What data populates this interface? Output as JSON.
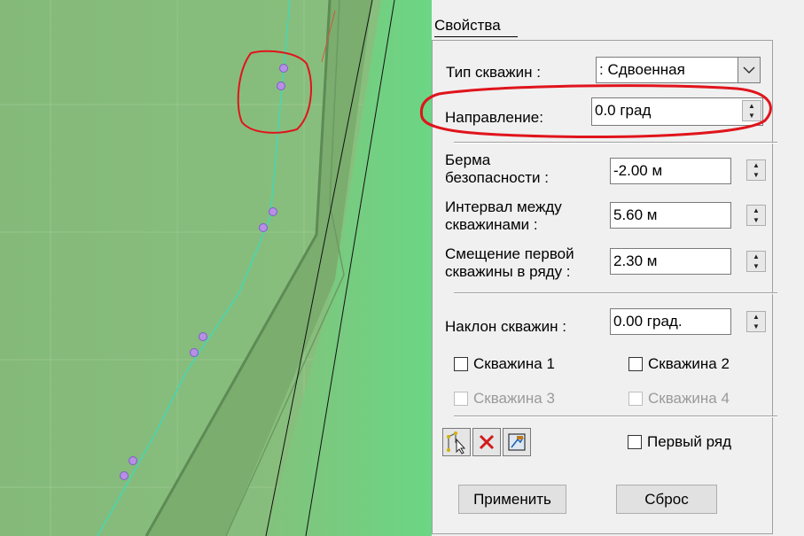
{
  "panel": {
    "title": "Свойства",
    "well_type": {
      "label": "Тип скважин :",
      "value": ": Сдвоенная"
    },
    "direction": {
      "label": "Направление:",
      "value": "0.0 град"
    },
    "safety_berm": {
      "label_line1": "Берма",
      "label_line2": "безопасности :",
      "value": "-2.00 м"
    },
    "well_interval": {
      "label_line1": "Интервал между",
      "label_line2": "скважинами :",
      "value": "5.60 м"
    },
    "first_well_offset": {
      "label_line1": "Смещение первой",
      "label_line2": "скважины в ряду :",
      "value": "2.30 м"
    },
    "well_incline": {
      "label": "Наклон скважин :",
      "value": "0.00 град."
    },
    "checkboxes": {
      "well1": {
        "label": "Скважина 1",
        "enabled": true,
        "checked": false
      },
      "well2": {
        "label": "Скважина 2",
        "enabled": true,
        "checked": false
      },
      "well3": {
        "label": "Скважина 3",
        "enabled": false,
        "checked": false
      },
      "well4": {
        "label": "Скважина 4",
        "enabled": false,
        "checked": false
      },
      "first_row": {
        "label": "Первый ряд",
        "enabled": true,
        "checked": false
      }
    },
    "buttons": {
      "apply": "Применить",
      "reset": "Сброс"
    },
    "icons": [
      "path-edit-icon",
      "delete-icon",
      "pick-icon"
    ]
  },
  "colors": {
    "map_green": "#82b877",
    "map_bench": "#78aa6c",
    "well_line": "#46d7b4",
    "well_marker": "#b88fe6",
    "annotation_red": "#e0141c"
  }
}
